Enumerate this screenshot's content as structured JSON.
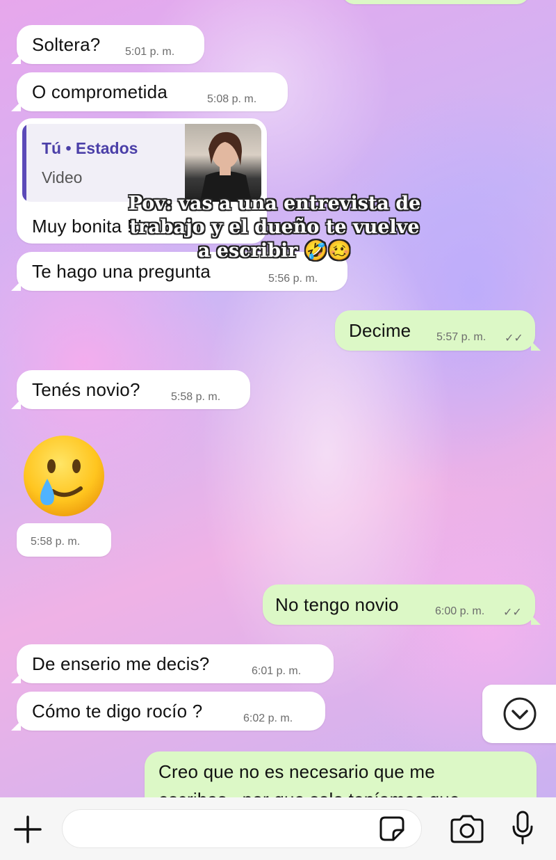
{
  "messages": [
    {
      "text": "Soltera?",
      "time": "5:01 p. m."
    },
    {
      "text": "O comprometida",
      "time": "5:08 p. m."
    },
    {
      "reply_title": "Tú • Estados",
      "reply_type": "Video",
      "text": "Muy bonita !!!"
    },
    {
      "text": "Te hago una pregunta",
      "time": "5:56 p. m."
    },
    {
      "text": "Decime",
      "time": "5:57 p. m.",
      "ticks": "✓✓"
    },
    {
      "text": "Tenés novio?",
      "time": "5:58 p. m."
    },
    {
      "emoji": "🥲",
      "time": "5:58 p. m."
    },
    {
      "text": "No tengo novio",
      "time": "6:00 p. m.",
      "ticks": "✓✓"
    },
    {
      "text": "De enserio me decis?",
      "time": "6:01 p. m."
    },
    {
      "text": "Cómo te digo rocío ?",
      "time": "6:02 p. m."
    },
    {
      "text": "Creo que no es necesario que me",
      "text2": "escribas , por que solo teníamos que"
    }
  ],
  "overlay": {
    "line1": "Pov: vas a una entrevista de",
    "line2": "trabajo y el dueño te vuelve",
    "line3": "a escribir 🤣🥴"
  },
  "icons": {
    "scroll_down": "chevron-down-circle-icon",
    "attach": "plus-icon",
    "sticker": "sticker-icon",
    "camera": "camera-icon",
    "mic": "microphone-icon"
  },
  "colors": {
    "incoming_bubble": "#ffffff",
    "outgoing_bubble": "#dcf8c6",
    "reply_accent": "#5b4ab8",
    "bottom_bar": "#f6f6f6"
  }
}
